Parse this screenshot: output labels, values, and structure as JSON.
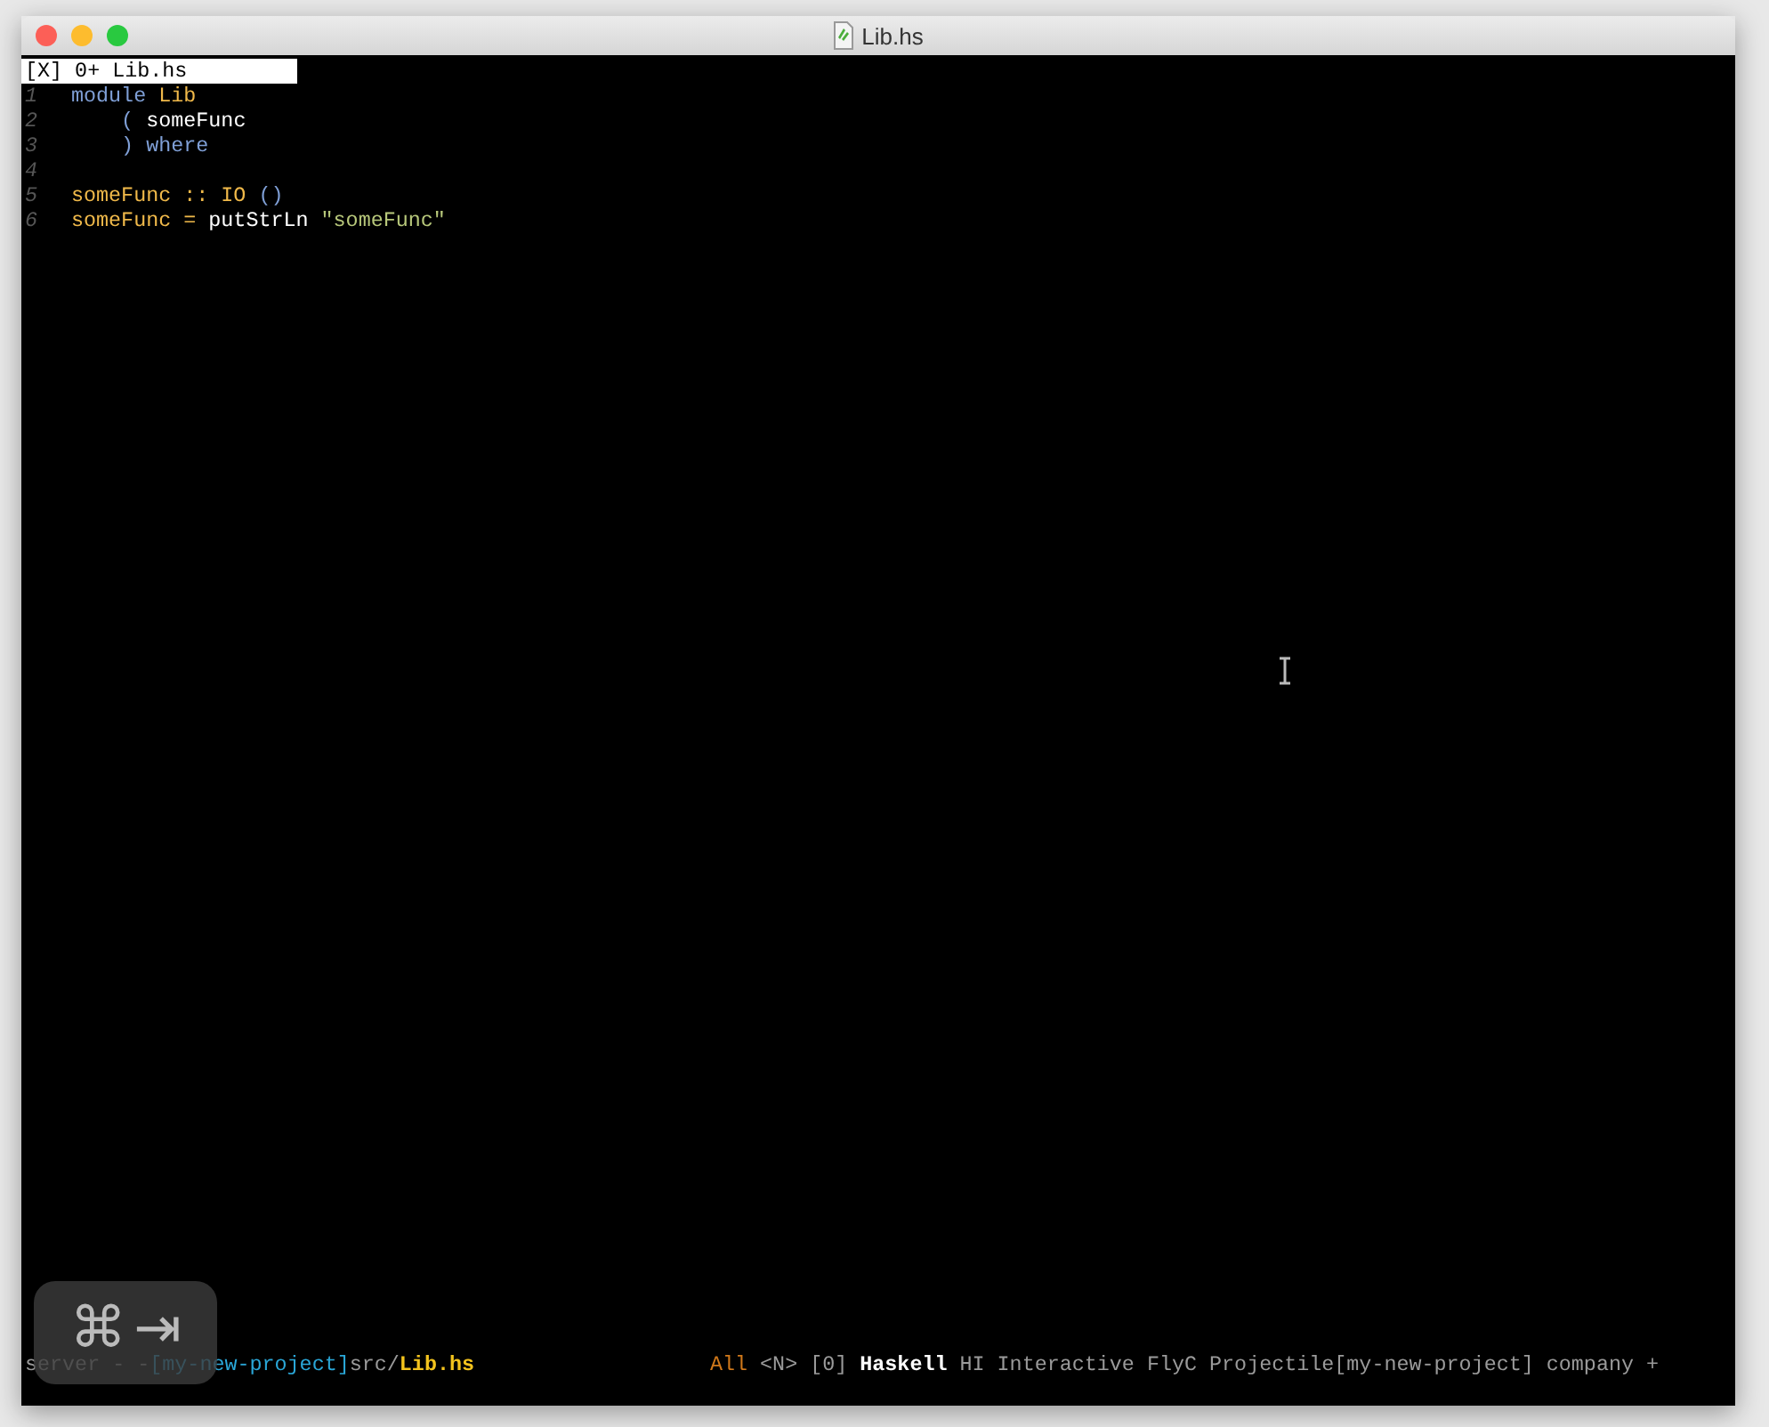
{
  "window": {
    "title": "Lib.hs"
  },
  "tab": {
    "text": "[X] 0+ Lib.hs"
  },
  "lines": [
    {
      "number": "1",
      "tokens": [
        {
          "text": "module ",
          "kind": "keyword"
        },
        {
          "text": "Lib",
          "kind": "type"
        }
      ]
    },
    {
      "number": "2",
      "tokens": [
        {
          "text": "    ( ",
          "kind": "keyword"
        },
        {
          "text": "someFunc",
          "kind": "plain"
        }
      ]
    },
    {
      "number": "3",
      "tokens": [
        {
          "text": "    ) where",
          "kind": "keyword"
        }
      ]
    },
    {
      "number": "4"
    },
    {
      "number": "5",
      "tokens": [
        {
          "text": "someFunc",
          "kind": "type"
        },
        {
          "text": " :: ",
          "kind": "operator"
        },
        {
          "text": "IO",
          "kind": "type"
        },
        {
          "text": " ()",
          "kind": "keyword"
        }
      ]
    },
    {
      "number": "6",
      "tokens": [
        {
          "text": "someFunc",
          "kind": "type"
        },
        {
          "text": " = ",
          "kind": "operator"
        },
        {
          "text": "putStrLn ",
          "kind": "plain"
        },
        {
          "text": "\"someFunc\"",
          "kind": "string"
        }
      ]
    }
  ],
  "status_left": [
    {
      "text": "server - -",
      "kind": "dim"
    },
    {
      "text": "[my-new-project]",
      "kind": "project"
    },
    {
      "text": "src/",
      "kind": "dim"
    },
    {
      "text": "Lib.hs",
      "kind": "file"
    }
  ],
  "status_right": [
    {
      "text": "All",
      "kind": "position"
    },
    {
      "text": "<N>",
      "kind": "dim"
    },
    {
      "text": "[0]",
      "kind": "dim"
    },
    {
      "text": "Haskell",
      "kind": "mode"
    },
    {
      "text": "HI Interactive FlyC Projectile[my-new-project] company +",
      "kind": "dim"
    }
  ],
  "hud": {
    "keys": [
      "⌘",
      "⇥"
    ]
  }
}
